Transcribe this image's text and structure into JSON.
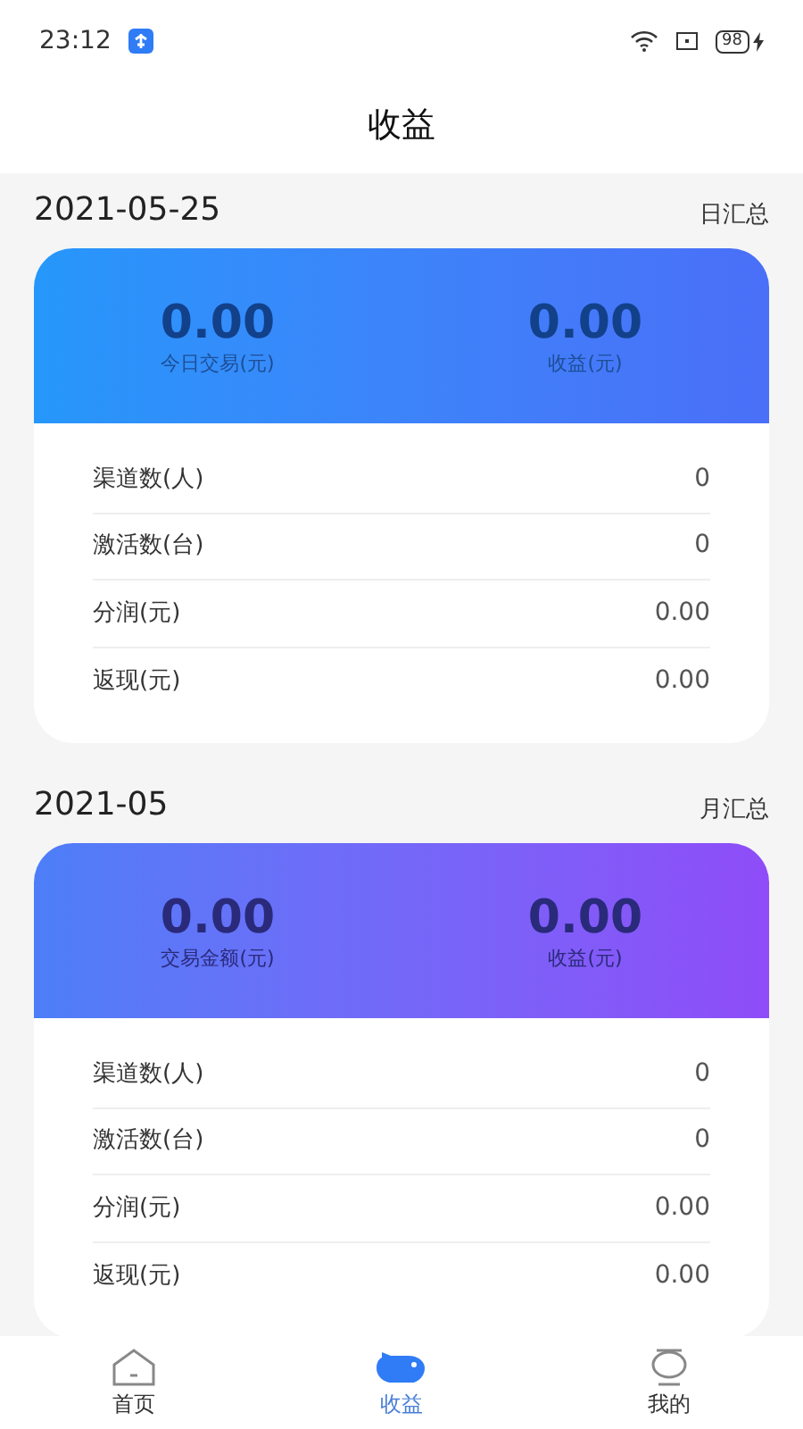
{
  "status_bar": {
    "time": "23:12",
    "battery": "98"
  },
  "title": "收益",
  "sections": [
    {
      "date": "2021-05-25",
      "summary_label": "日汇总",
      "stats": [
        {
          "value": "0.00",
          "label": "今日交易(元)"
        },
        {
          "value": "0.00",
          "label": "收益(元)"
        }
      ],
      "rows": [
        {
          "label": "渠道数(人)",
          "value": "0"
        },
        {
          "label": "激活数(台)",
          "value": "0"
        },
        {
          "label": "分润(元)",
          "value": "0.00"
        },
        {
          "label": "返现(元)",
          "value": "0.00"
        }
      ]
    },
    {
      "date": "2021-05",
      "summary_label": "月汇总",
      "stats": [
        {
          "value": "0.00",
          "label": "交易金额(元)"
        },
        {
          "value": "0.00",
          "label": "收益(元)"
        }
      ],
      "rows": [
        {
          "label": "渠道数(人)",
          "value": "0"
        },
        {
          "label": "激活数(台)",
          "value": "0"
        },
        {
          "label": "分润(元)",
          "value": "0.00"
        },
        {
          "label": "返现(元)",
          "value": "0.00"
        }
      ]
    }
  ],
  "tabs": [
    {
      "label": "首页",
      "selected": false
    },
    {
      "label": "收益",
      "selected": true
    },
    {
      "label": "我的",
      "selected": false
    }
  ]
}
